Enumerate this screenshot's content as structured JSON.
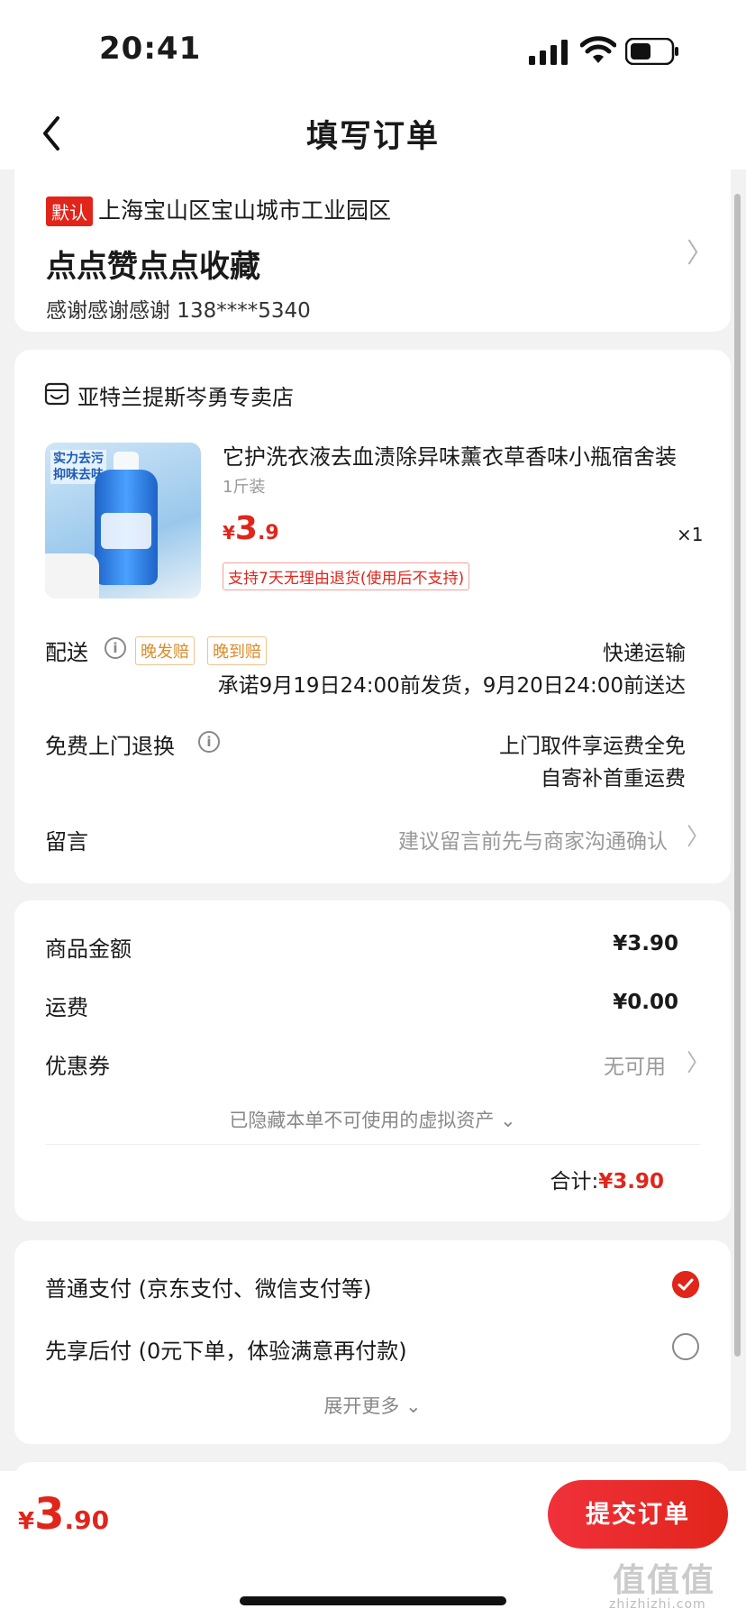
{
  "status_bar": {
    "time": "20:41"
  },
  "header": {
    "title": "填写订单"
  },
  "address": {
    "default_tag": "默认",
    "region": "上海宝山区宝山城市工业园区",
    "detail": "点点赞点点收藏",
    "contact": "感谢感谢感谢  138****5340",
    "chevron": "〉"
  },
  "store": {
    "name": "亚特兰提斯岑勇专卖店",
    "product": {
      "image_text": "实力去污\n抑味去味",
      "title": "它护洗衣液去血渍除异味薰衣草香味小瓶宿舍装",
      "spec": "1斤装",
      "price_currency": "¥",
      "price_int": "3",
      "price_dec": ".9",
      "quantity": "×1",
      "return_policy": "支持7天无理由退货(使用后不支持)"
    },
    "delivery": {
      "label": "配送",
      "tags": [
        "晚发赔",
        "晚到赔"
      ],
      "method": "快递运输",
      "promise": "承诺9月19日24:00前发货，9月20日24:00前送达"
    },
    "free_return": {
      "label": "免费上门退换",
      "line1": "上门取件享运费全免",
      "line2": "自寄补首重运费"
    },
    "message": {
      "label": "留言",
      "placeholder": "建议留言前先与商家沟通确认",
      "chevron": "〉"
    }
  },
  "price_summary": {
    "goods_label": "商品金额",
    "goods_value": "¥3.90",
    "shipping_label": "运费",
    "shipping_value": "¥0.00",
    "coupon_label": "优惠券",
    "coupon_value": "无可用",
    "coupon_chevron": "〉",
    "hidden_assets": "已隐藏本单不可使用的虚拟资产 ⌄",
    "total_label": "合计:",
    "total_value": "¥3.90"
  },
  "payment": {
    "options": [
      {
        "label": "普通支付 (京东支付、微信支付等)",
        "selected": true
      },
      {
        "label": "先享后付 (0元下单，体验满意再付款)",
        "selected": false
      }
    ],
    "expand": "展开更多 ⌄"
  },
  "footer": {
    "price_currency": "¥",
    "price_int": "3",
    "price_dec": ".90",
    "submit_label": "提交订单"
  },
  "watermark": {
    "text": "值值值",
    "sub": "zhizhizhi.com"
  },
  "colors": {
    "accent": "#e1251b",
    "background": "#f2f2f2",
    "tag_orange": "#d98c2a"
  }
}
